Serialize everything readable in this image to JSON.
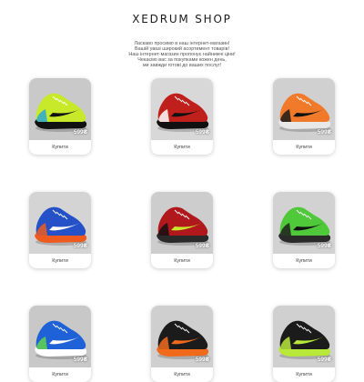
{
  "shop": {
    "title": "XEDRUM SHOP",
    "intro": [
      "Ласкаво просимо в наш інтернет-магазин!",
      "Вашій увазі широкий асортимент товарів!",
      "Наш інтернет-магазин пропонує найнижчі ціни!",
      "Чекаємо вас за покупками кожен день,",
      "ми завжди готові до ваших послуг!"
    ]
  },
  "products": [
    {
      "price": "599₴",
      "buy_label": "Купити",
      "colors": {
        "bg": "#c9c9c9",
        "upper": "#c8e82a",
        "accent": "#2aa7d6",
        "sole": "#111111",
        "swoosh": "#111111"
      }
    },
    {
      "price": "599₴",
      "buy_label": "Купити",
      "colors": {
        "bg": "#d8d8d8",
        "upper": "#c0201c",
        "accent": "#ffffff",
        "sole": "#111111",
        "swoosh": "#111111"
      }
    },
    {
      "price": "599₴",
      "buy_label": "Купити",
      "colors": {
        "bg": "#d0d0d0",
        "upper": "#f07a2a",
        "accent": "#1a1a1a",
        "sole": "#e8e8e8",
        "swoosh": "#111111"
      }
    },
    {
      "price": "599₴",
      "buy_label": "Купити",
      "colors": {
        "bg": "#d4d4d4",
        "upper": "#2451c8",
        "accent": "#ef5a1e",
        "sole": "#ef5a1e",
        "swoosh": "#ffffff"
      }
    },
    {
      "price": "599₴",
      "buy_label": "Купити",
      "colors": {
        "bg": "#cdcdcd",
        "upper": "#b0181c",
        "accent": "#111111",
        "sole": "#2a2a2a",
        "swoosh": "#c8e82a"
      }
    },
    {
      "price": "599₴",
      "buy_label": "Купити",
      "colors": {
        "bg": "#d2d2d2",
        "upper": "#4fc83a",
        "accent": "#1e1e1e",
        "sole": "#2a2a2a",
        "swoosh": "#111111"
      }
    },
    {
      "price": "599₴",
      "buy_label": "Купити",
      "colors": {
        "bg": "#c8c8c8",
        "upper": "#1f62d8",
        "accent": "#63d64a",
        "sole": "#ffffff",
        "swoosh": "#ffffff"
      }
    },
    {
      "price": "599₴",
      "buy_label": "Купити",
      "colors": {
        "bg": "#cfcfcf",
        "upper": "#1b1b1b",
        "accent": "#f06a1c",
        "sole": "#f06a1c",
        "swoosh": "#f06a1c"
      }
    },
    {
      "price": "599₴",
      "buy_label": "Купити",
      "colors": {
        "bg": "#d0d0d0",
        "upper": "#1b1b1b",
        "accent": "#b8e83a",
        "sole": "#b8e83a",
        "swoosh": "#b8e83a"
      }
    }
  ]
}
